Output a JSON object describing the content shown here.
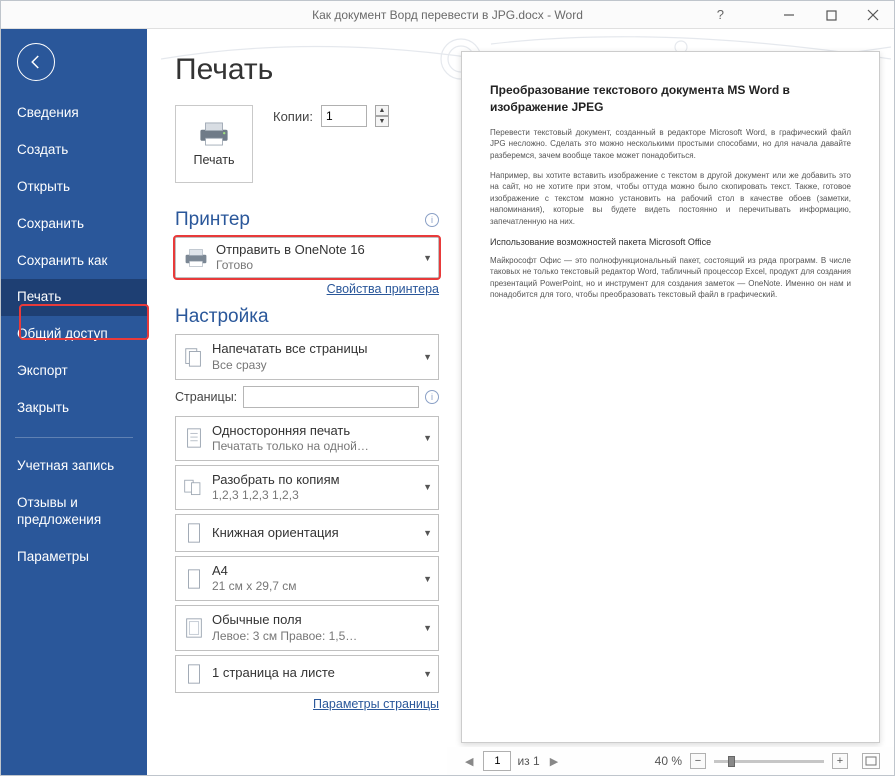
{
  "titlebar": {
    "title": "Как документ Ворд перевести в JPG.docx  -  Word",
    "help": "?"
  },
  "sidebar": {
    "items": [
      "Сведения",
      "Создать",
      "Открыть",
      "Сохранить",
      "Сохранить как",
      "Печать",
      "Общий доступ",
      "Экспорт",
      "Закрыть"
    ],
    "lower": [
      "Учетная запись",
      "Отзывы и предложения",
      "Параметры"
    ],
    "active_index": 5
  },
  "main": {
    "heading": "Печать",
    "print_button": "Печать",
    "copies_label": "Копии:",
    "copies_value": "1",
    "printer_section": "Принтер",
    "printer_selected": {
      "title": "Отправить в OneNote 16",
      "status": "Готово"
    },
    "printer_props_link": "Свойства принтера",
    "settings_section": "Настройка",
    "settings": [
      {
        "title": "Напечатать все страницы",
        "sub": "Все сразу"
      }
    ],
    "pages_label": "Страницы:",
    "pages_value": "",
    "settings2": [
      {
        "title": "Односторонняя печать",
        "sub": "Печатать только на одной…"
      },
      {
        "title": "Разобрать по копиям",
        "sub": "1,2,3    1,2,3    1,2,3"
      },
      {
        "title": "Книжная ориентация",
        "sub": ""
      },
      {
        "title": "A4",
        "sub": "21 см x 29,7 см"
      },
      {
        "title": "Обычные поля",
        "sub": "Левое:  3 см   Правое:  1,5…"
      },
      {
        "title": "1 страница на листе",
        "sub": ""
      }
    ],
    "page_params_link": "Параметры страницы"
  },
  "preview": {
    "doc_title": "Преобразование текстового документа MS Word в изображение JPEG",
    "p1": "Перевести текстовый документ, созданный в редакторе Microsoft Word, в графический файл JPG несложно. Сделать это можно несколькими простыми способами, но для начала давайте разберемся, зачем вообще такое может понадобиться.",
    "p2": "Например, вы хотите вставить изображение с текстом в другой документ или же добавить это на сайт, но не хотите при этом, чтобы оттуда можно было скопировать текст. Также, готовое изображение с текстом можно установить на рабочий стол в качестве обоев (заметки, напоминания), которые вы будете видеть постоянно и перечитывать информацию, запечатленную на них.",
    "sub": "Использование возможностей пакета Microsoft Office",
    "p3": "Майкрософт Офис — это полнофункциональный пакет, состоящий из ряда программ. В числе таковых не только текстовый редактор Word, табличный процессор Excel, продукт для создания презентаций PowerPoint, но и инструмент для создания заметок — OneNote. Именно он нам и понадобится для того, чтобы преобразовать текстовый файл в графический."
  },
  "footer": {
    "page_current": "1",
    "page_total_label": "из 1",
    "zoom_label": "40 %"
  }
}
